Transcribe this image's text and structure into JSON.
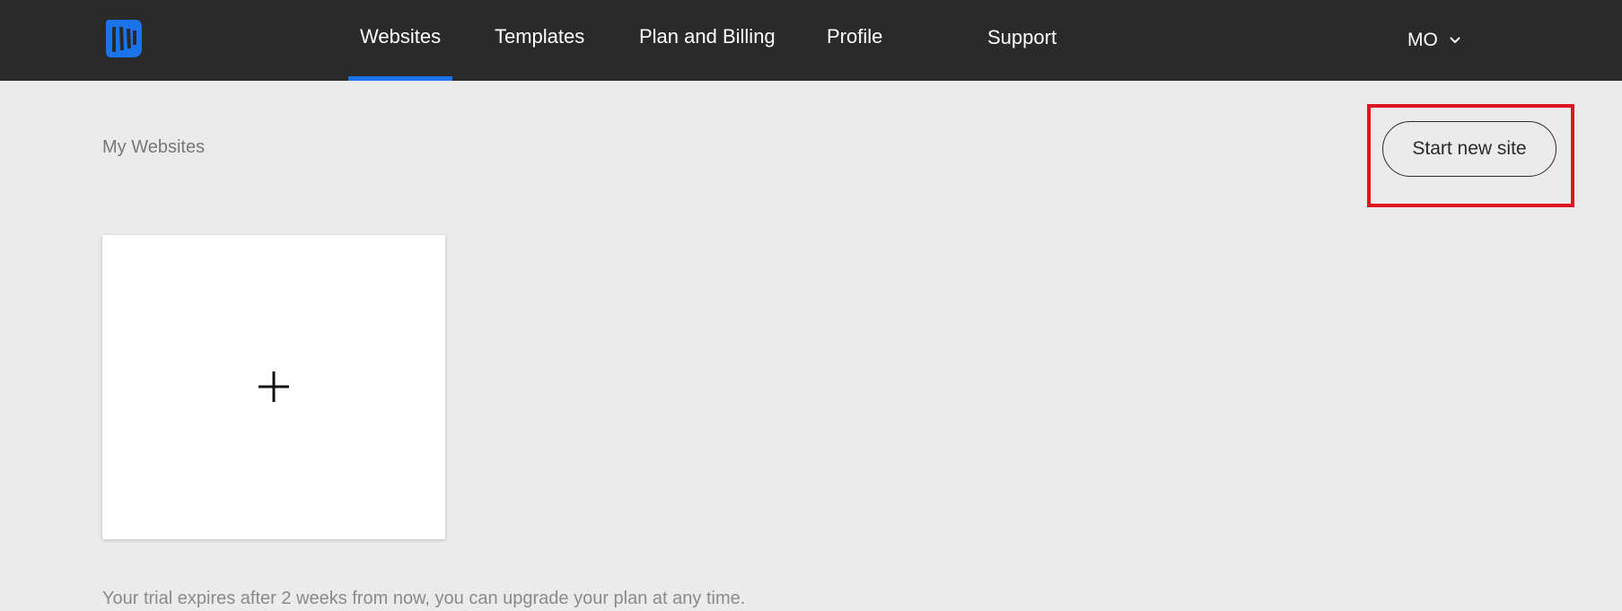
{
  "app": {
    "logo_icon": "brand-logo-icon",
    "accent_color": "#1a73e8"
  },
  "nav": {
    "items": [
      {
        "label": "Websites",
        "active": true
      },
      {
        "label": "Templates",
        "active": false
      },
      {
        "label": "Plan and Billing",
        "active": false
      },
      {
        "label": "Profile",
        "active": false
      },
      {
        "label": "Support",
        "active": false
      }
    ],
    "user": {
      "initials": "MO",
      "icon": "chevron-down-icon"
    }
  },
  "main": {
    "section_title": "My Websites",
    "start_button_label": "Start new site",
    "new_site_card_icon": "plus-icon",
    "trial_notice": "Your trial expires after 2 weeks from now, you can upgrade your plan at any time."
  },
  "annotation": {
    "highlight_color": "#e0141e"
  }
}
